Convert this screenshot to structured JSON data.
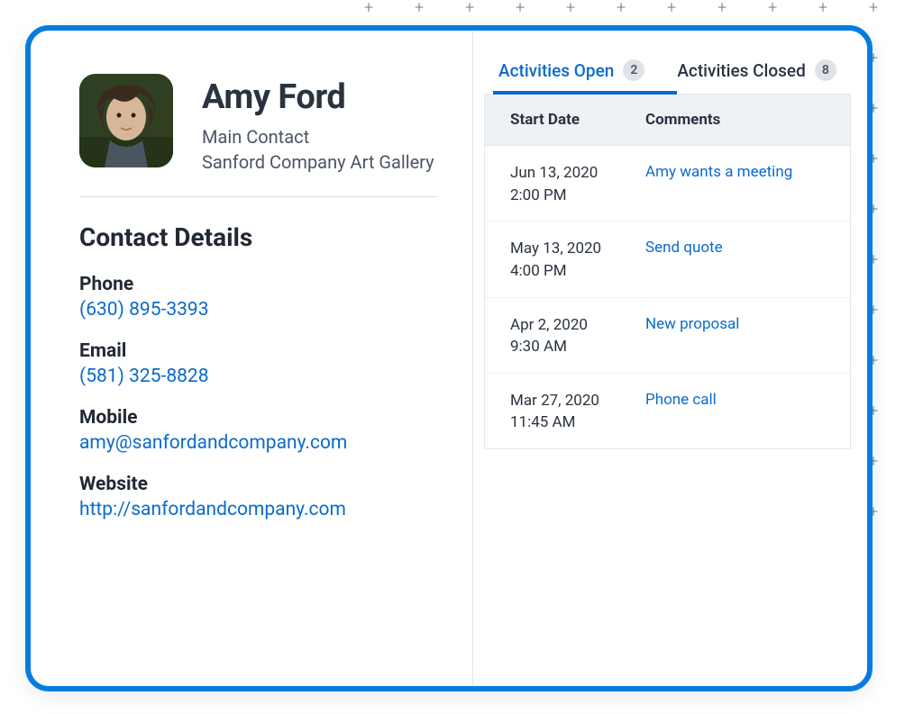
{
  "contact": {
    "name": "Amy Ford",
    "role": "Main Contact",
    "company": "Sanford Company Art Gallery"
  },
  "details": {
    "section_title": "Contact Details",
    "phone_label": "Phone",
    "phone_value": "(630) 895-3393",
    "email_label": "Email",
    "email_value": "(581) 325-8828",
    "mobile_label": "Mobile",
    "mobile_value": "amy@sanfordandcompany.com",
    "website_label": "Website",
    "website_value": "http://sanfordandcompany.com"
  },
  "tabs": {
    "open_label": "Activities Open",
    "open_count": "2",
    "closed_label": "Activities Closed",
    "closed_count": "8"
  },
  "table": {
    "header_date": "Start Date",
    "header_comments": "Comments",
    "rows": [
      {
        "date": "Jun 13, 2020",
        "time": "2:00 PM",
        "comment": "Amy wants a meeting"
      },
      {
        "date": "May 13, 2020",
        "time": "4:00 PM",
        "comment": "Send quote"
      },
      {
        "date": "Apr 2, 2020",
        "time": "9:30 AM",
        "comment": "New proposal"
      },
      {
        "date": "Mar 27, 2020",
        "time": "11:45 AM",
        "comment": "Phone call"
      }
    ]
  }
}
